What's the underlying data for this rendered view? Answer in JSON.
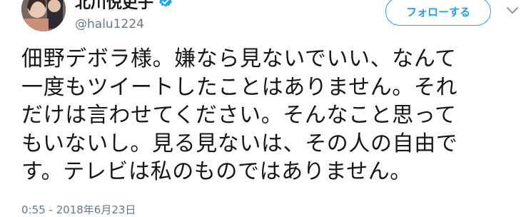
{
  "author": {
    "display_name": "北川悦吏子",
    "handle": "@halu1224",
    "verified": true
  },
  "follow_button": {
    "label": "フォローする"
  },
  "menu": {
    "icon": "chevron-down-icon"
  },
  "tweet": {
    "text": "佃野デボラ様。嫌なら見ないでいい、なんて\n一度もツイートしたことはありません。それ\nだけは言わせてください。そんなこと思って\nもいないし。見る見ないは、その人の自由で\nす。テレビは私のものではありません。",
    "timestamp": "0:55 - 2018年6月23日"
  },
  "colors": {
    "accent": "#1da1f2",
    "text": "#14171a",
    "muted": "#657786"
  }
}
